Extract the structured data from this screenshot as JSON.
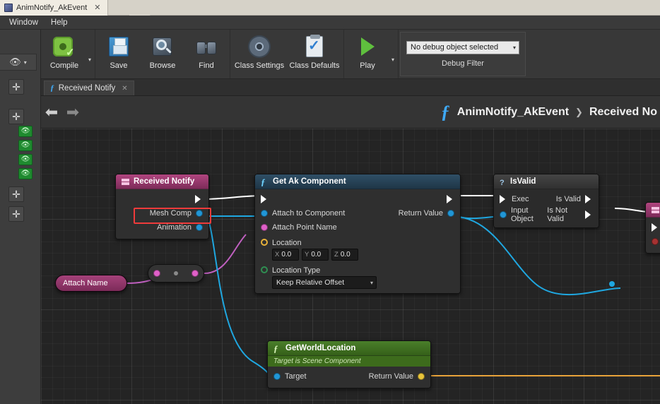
{
  "window": {
    "tab_title": "AnimNotify_AkEvent",
    "tab_close": "✕"
  },
  "menu": {
    "items": [
      "Window",
      "Help"
    ]
  },
  "toolbar": {
    "groups": [
      {
        "buttons": [
          {
            "label": "Compile",
            "icon": "compile-icon",
            "caret": "▾"
          }
        ]
      },
      {
        "buttons": [
          {
            "label": "Save",
            "icon": "save-icon"
          },
          {
            "label": "Browse",
            "icon": "browse-icon"
          },
          {
            "label": "Find",
            "icon": "find-icon"
          }
        ]
      },
      {
        "buttons": [
          {
            "label": "Class Settings",
            "icon": "gear-icon"
          },
          {
            "label": "Class Defaults",
            "icon": "class-defaults-icon"
          }
        ]
      },
      {
        "buttons": [
          {
            "label": "Play",
            "icon": "play-icon",
            "caret": "▾"
          }
        ]
      }
    ],
    "debug": {
      "combo_value": "No debug object selected",
      "combo_caret": "▾",
      "label": "Debug Filter"
    }
  },
  "left_strip": {
    "eye_icon": "eye-icon",
    "eye_caret": "▾",
    "plus": "✛",
    "eye_small": "👁"
  },
  "subtab": {
    "fx": "ƒ",
    "label": "Received Notify",
    "close": "✕"
  },
  "breadcrumb": {
    "back": "⬅",
    "forward": "➡",
    "fx": "ƒ",
    "root": "AnimNotify_AkEvent",
    "separator": "❯",
    "current": "Received No"
  },
  "graph": {
    "nodes": {
      "received_notify": {
        "title": "Received Notify",
        "icon": "event-node-icon",
        "out_exec": "exec-out-pin",
        "pins": [
          {
            "label": "Mesh Comp",
            "type": "object",
            "selected": true
          },
          {
            "label": "Animation",
            "type": "object",
            "selected": false
          }
        ]
      },
      "get_ak_component": {
        "title": "Get Ak Component",
        "icon": "function-icon",
        "in_exec": "exec-in-pin",
        "out_exec": "exec-out-pin",
        "inputs": [
          {
            "label": "Attach to Component",
            "type": "object"
          },
          {
            "label": "Attach Point Name",
            "type": "name"
          }
        ],
        "outputs": [
          {
            "label": "Return Value",
            "type": "object"
          }
        ],
        "location": {
          "label": "Location",
          "fields": [
            {
              "axis": "X",
              "value": "0.0"
            },
            {
              "axis": "Y",
              "value": "0.0"
            },
            {
              "axis": "Z",
              "value": "0.0"
            }
          ]
        },
        "location_type": {
          "label": "Location Type",
          "value": "Keep Relative Offset",
          "caret": "▾"
        }
      },
      "is_valid": {
        "title": "IsValid",
        "icon": "question-mark-icon",
        "rows": [
          {
            "in_label": "Exec",
            "in_type": "exec",
            "out_label": "Is Valid",
            "out_type": "exec"
          },
          {
            "in_label": "Input Object",
            "in_type": "object",
            "out_label": "Is Not Valid",
            "out_type": "exec"
          }
        ]
      },
      "get_world_location": {
        "title": "GetWorldLocation",
        "subtitle": "Target is Scene Component",
        "icon": "function-icon",
        "inputs": [
          {
            "label": "Target",
            "type": "object"
          }
        ],
        "outputs": [
          {
            "label": "Return Value",
            "type": "vector"
          }
        ]
      },
      "attach_name": {
        "title": "Attach Name"
      },
      "reroute": {
        "name": "reroute-node"
      },
      "right_node": {
        "title": "",
        "in_exec": "exec-in-pin",
        "bool_pin": "bool-in-pin"
      }
    },
    "colors": {
      "exec_wire": "#ffffff",
      "object_wire": "#1fa7e0",
      "name_wire": "#c060c0",
      "vector_wire": "#e8a33a",
      "selection": "#ef3b3b",
      "event_header": "#b0457f",
      "function_header": "#2f4f66",
      "pure_header": "#4a7f2a"
    }
  }
}
